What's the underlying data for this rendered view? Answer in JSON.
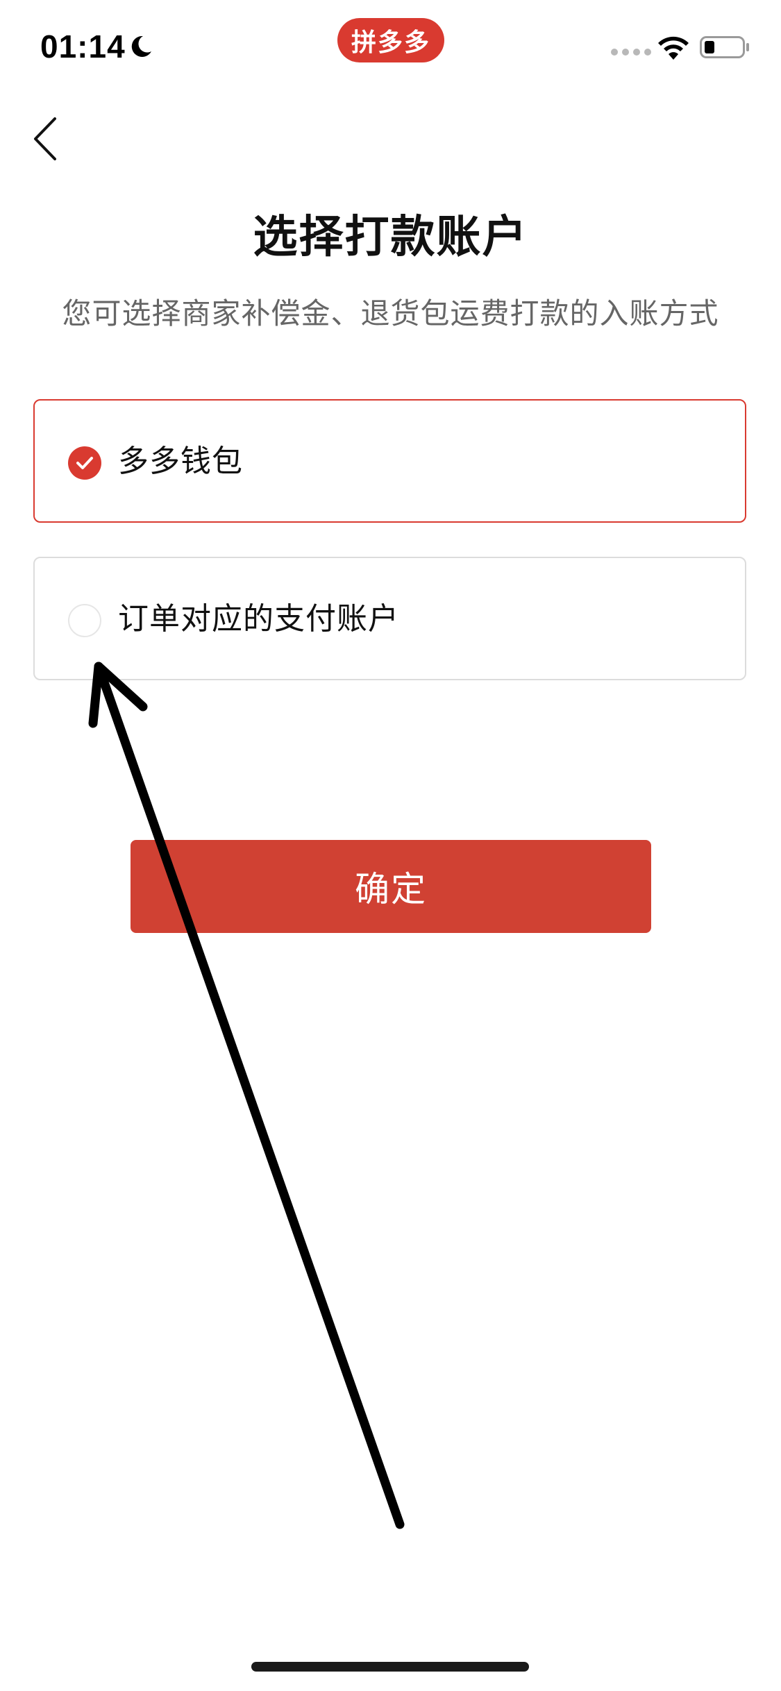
{
  "status_bar": {
    "time": "01:14",
    "app_badge": "拼多多"
  },
  "page": {
    "title": "选择打款账户",
    "subtitle": "您可选择商家补偿金、退货包运费打款的入账方式"
  },
  "options": [
    {
      "label": "多多钱包",
      "selected": true
    },
    {
      "label": "订单对应的支付账户",
      "selected": false
    }
  ],
  "confirm_label": "确定",
  "colors": {
    "accent": "#d93a30",
    "button": "#d04133",
    "subtitle": "#666666",
    "border": "#dcdcdc"
  }
}
